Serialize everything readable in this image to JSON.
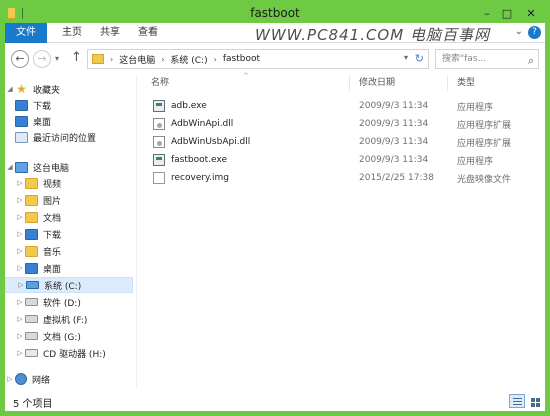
{
  "window": {
    "title": "fastboot"
  },
  "ribbon": {
    "tabs": [
      {
        "label": "文件"
      },
      {
        "label": "主页"
      },
      {
        "label": "共享"
      },
      {
        "label": "查看"
      }
    ],
    "watermark": "WWW.PC841.COM 电脑百事网"
  },
  "address": {
    "crumbs": [
      "这台电脑",
      "系统 (C:)",
      "fastboot"
    ]
  },
  "search": {
    "placeholder": "搜索\"fas..."
  },
  "nav": {
    "favorites": {
      "label": "收藏夹",
      "items": [
        {
          "label": "下载"
        },
        {
          "label": "桌面"
        },
        {
          "label": "最近访问的位置"
        }
      ]
    },
    "this_pc": {
      "label": "这台电脑",
      "items": [
        {
          "label": "视频"
        },
        {
          "label": "图片"
        },
        {
          "label": "文档"
        },
        {
          "label": "下载"
        },
        {
          "label": "音乐"
        },
        {
          "label": "桌面"
        },
        {
          "label": "系统 (C:)"
        },
        {
          "label": "软件 (D:)"
        },
        {
          "label": "虚拟机 (F:)"
        },
        {
          "label": "文档 (G:)"
        },
        {
          "label": "CD 驱动器 (H:)"
        }
      ]
    },
    "network": {
      "label": "网络"
    }
  },
  "files": {
    "columns": {
      "name": "名称",
      "date": "修改日期",
      "type": "类型"
    },
    "rows": [
      {
        "name": "adb.exe",
        "date": "2009/9/3 11:34",
        "type": "应用程序",
        "icon": "exe"
      },
      {
        "name": "AdbWinApi.dll",
        "date": "2009/9/3 11:34",
        "type": "应用程序扩展",
        "icon": "dll"
      },
      {
        "name": "AdbWinUsbApi.dll",
        "date": "2009/9/3 11:34",
        "type": "应用程序扩展",
        "icon": "dll"
      },
      {
        "name": "fastboot.exe",
        "date": "2009/9/3 11:34",
        "type": "应用程序",
        "icon": "exe"
      },
      {
        "name": "recovery.img",
        "date": "2015/2/25 17:38",
        "type": "光盘映像文件",
        "icon": "img"
      }
    ]
  },
  "status": {
    "item_count": "5 个项目"
  },
  "colors": {
    "frame": "#6fca43",
    "file_tab": "#1979ca",
    "selection": "#dcebfc"
  }
}
